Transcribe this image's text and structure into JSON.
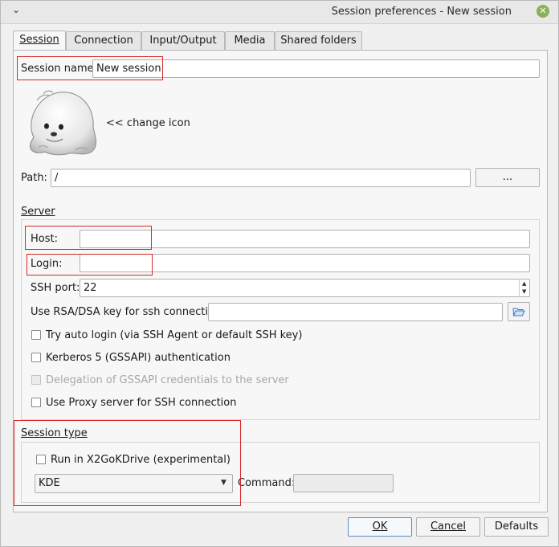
{
  "window": {
    "title": "Session preferences - New session",
    "menu_glyph": "⌄",
    "close_glyph": "✕"
  },
  "tabs": [
    {
      "label": "Session",
      "active": true
    },
    {
      "label": "Connection",
      "active": false
    },
    {
      "label": "Input/Output",
      "active": false
    },
    {
      "label": "Media",
      "active": false
    },
    {
      "label": "Shared folders",
      "active": false
    }
  ],
  "session": {
    "name_label": "Session name:",
    "name_value": "New session",
    "change_icon_label": "<< change icon",
    "path_label": "Path:",
    "path_value": "/",
    "path_browse_label": "..."
  },
  "server": {
    "group_label": "Server",
    "host_label": "Host:",
    "host_value": "",
    "login_label": "Login:",
    "login_value": "",
    "ssh_port_label": "SSH port:",
    "ssh_port_value": "22",
    "rsa_label": "Use RSA/DSA key for ssh connection:",
    "rsa_value": "",
    "auto_login_label": "Try auto login (via SSH Agent or default SSH key)",
    "kerberos_label": "Kerberos 5 (GSSAPI) authentication",
    "delegation_label": "Delegation of GSSAPI credentials to the server",
    "proxy_label": "Use Proxy server for SSH connection"
  },
  "session_type": {
    "group_label": "Session type",
    "x2go_label": "Run in X2GoKDrive (experimental)",
    "type_value": "KDE",
    "command_label": "Command:",
    "command_value": ""
  },
  "buttons": {
    "ok": "OK",
    "cancel": "Cancel",
    "defaults": "Defaults"
  },
  "colors": {
    "highlight": "#d42a2a",
    "close_button": "#8bb158",
    "default_button_border": "#5a8fc7"
  }
}
